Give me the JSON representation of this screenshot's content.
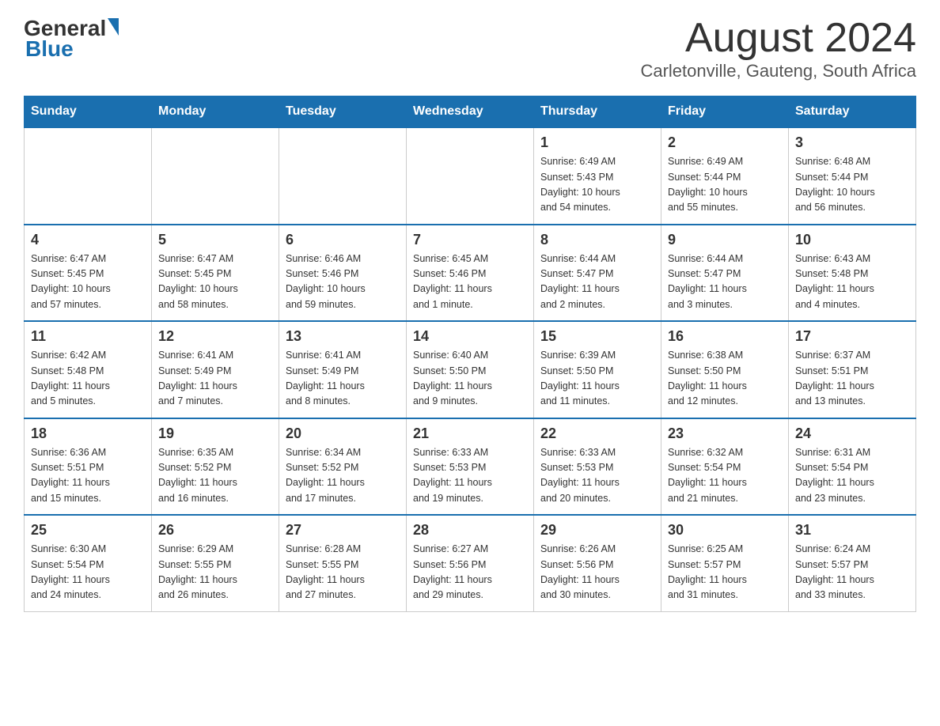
{
  "header": {
    "logo_general": "General",
    "logo_blue": "Blue",
    "title": "August 2024",
    "location": "Carletonville, Gauteng, South Africa"
  },
  "weekdays": [
    "Sunday",
    "Monday",
    "Tuesday",
    "Wednesday",
    "Thursday",
    "Friday",
    "Saturday"
  ],
  "rows": [
    {
      "cells": [
        {
          "day": "",
          "info": ""
        },
        {
          "day": "",
          "info": ""
        },
        {
          "day": "",
          "info": ""
        },
        {
          "day": "",
          "info": ""
        },
        {
          "day": "1",
          "info": "Sunrise: 6:49 AM\nSunset: 5:43 PM\nDaylight: 10 hours\nand 54 minutes."
        },
        {
          "day": "2",
          "info": "Sunrise: 6:49 AM\nSunset: 5:44 PM\nDaylight: 10 hours\nand 55 minutes."
        },
        {
          "day": "3",
          "info": "Sunrise: 6:48 AM\nSunset: 5:44 PM\nDaylight: 10 hours\nand 56 minutes."
        }
      ]
    },
    {
      "cells": [
        {
          "day": "4",
          "info": "Sunrise: 6:47 AM\nSunset: 5:45 PM\nDaylight: 10 hours\nand 57 minutes."
        },
        {
          "day": "5",
          "info": "Sunrise: 6:47 AM\nSunset: 5:45 PM\nDaylight: 10 hours\nand 58 minutes."
        },
        {
          "day": "6",
          "info": "Sunrise: 6:46 AM\nSunset: 5:46 PM\nDaylight: 10 hours\nand 59 minutes."
        },
        {
          "day": "7",
          "info": "Sunrise: 6:45 AM\nSunset: 5:46 PM\nDaylight: 11 hours\nand 1 minute."
        },
        {
          "day": "8",
          "info": "Sunrise: 6:44 AM\nSunset: 5:47 PM\nDaylight: 11 hours\nand 2 minutes."
        },
        {
          "day": "9",
          "info": "Sunrise: 6:44 AM\nSunset: 5:47 PM\nDaylight: 11 hours\nand 3 minutes."
        },
        {
          "day": "10",
          "info": "Sunrise: 6:43 AM\nSunset: 5:48 PM\nDaylight: 11 hours\nand 4 minutes."
        }
      ]
    },
    {
      "cells": [
        {
          "day": "11",
          "info": "Sunrise: 6:42 AM\nSunset: 5:48 PM\nDaylight: 11 hours\nand 5 minutes."
        },
        {
          "day": "12",
          "info": "Sunrise: 6:41 AM\nSunset: 5:49 PM\nDaylight: 11 hours\nand 7 minutes."
        },
        {
          "day": "13",
          "info": "Sunrise: 6:41 AM\nSunset: 5:49 PM\nDaylight: 11 hours\nand 8 minutes."
        },
        {
          "day": "14",
          "info": "Sunrise: 6:40 AM\nSunset: 5:50 PM\nDaylight: 11 hours\nand 9 minutes."
        },
        {
          "day": "15",
          "info": "Sunrise: 6:39 AM\nSunset: 5:50 PM\nDaylight: 11 hours\nand 11 minutes."
        },
        {
          "day": "16",
          "info": "Sunrise: 6:38 AM\nSunset: 5:50 PM\nDaylight: 11 hours\nand 12 minutes."
        },
        {
          "day": "17",
          "info": "Sunrise: 6:37 AM\nSunset: 5:51 PM\nDaylight: 11 hours\nand 13 minutes."
        }
      ]
    },
    {
      "cells": [
        {
          "day": "18",
          "info": "Sunrise: 6:36 AM\nSunset: 5:51 PM\nDaylight: 11 hours\nand 15 minutes."
        },
        {
          "day": "19",
          "info": "Sunrise: 6:35 AM\nSunset: 5:52 PM\nDaylight: 11 hours\nand 16 minutes."
        },
        {
          "day": "20",
          "info": "Sunrise: 6:34 AM\nSunset: 5:52 PM\nDaylight: 11 hours\nand 17 minutes."
        },
        {
          "day": "21",
          "info": "Sunrise: 6:33 AM\nSunset: 5:53 PM\nDaylight: 11 hours\nand 19 minutes."
        },
        {
          "day": "22",
          "info": "Sunrise: 6:33 AM\nSunset: 5:53 PM\nDaylight: 11 hours\nand 20 minutes."
        },
        {
          "day": "23",
          "info": "Sunrise: 6:32 AM\nSunset: 5:54 PM\nDaylight: 11 hours\nand 21 minutes."
        },
        {
          "day": "24",
          "info": "Sunrise: 6:31 AM\nSunset: 5:54 PM\nDaylight: 11 hours\nand 23 minutes."
        }
      ]
    },
    {
      "cells": [
        {
          "day": "25",
          "info": "Sunrise: 6:30 AM\nSunset: 5:54 PM\nDaylight: 11 hours\nand 24 minutes."
        },
        {
          "day": "26",
          "info": "Sunrise: 6:29 AM\nSunset: 5:55 PM\nDaylight: 11 hours\nand 26 minutes."
        },
        {
          "day": "27",
          "info": "Sunrise: 6:28 AM\nSunset: 5:55 PM\nDaylight: 11 hours\nand 27 minutes."
        },
        {
          "day": "28",
          "info": "Sunrise: 6:27 AM\nSunset: 5:56 PM\nDaylight: 11 hours\nand 29 minutes."
        },
        {
          "day": "29",
          "info": "Sunrise: 6:26 AM\nSunset: 5:56 PM\nDaylight: 11 hours\nand 30 minutes."
        },
        {
          "day": "30",
          "info": "Sunrise: 6:25 AM\nSunset: 5:57 PM\nDaylight: 11 hours\nand 31 minutes."
        },
        {
          "day": "31",
          "info": "Sunrise: 6:24 AM\nSunset: 5:57 PM\nDaylight: 11 hours\nand 33 minutes."
        }
      ]
    }
  ]
}
